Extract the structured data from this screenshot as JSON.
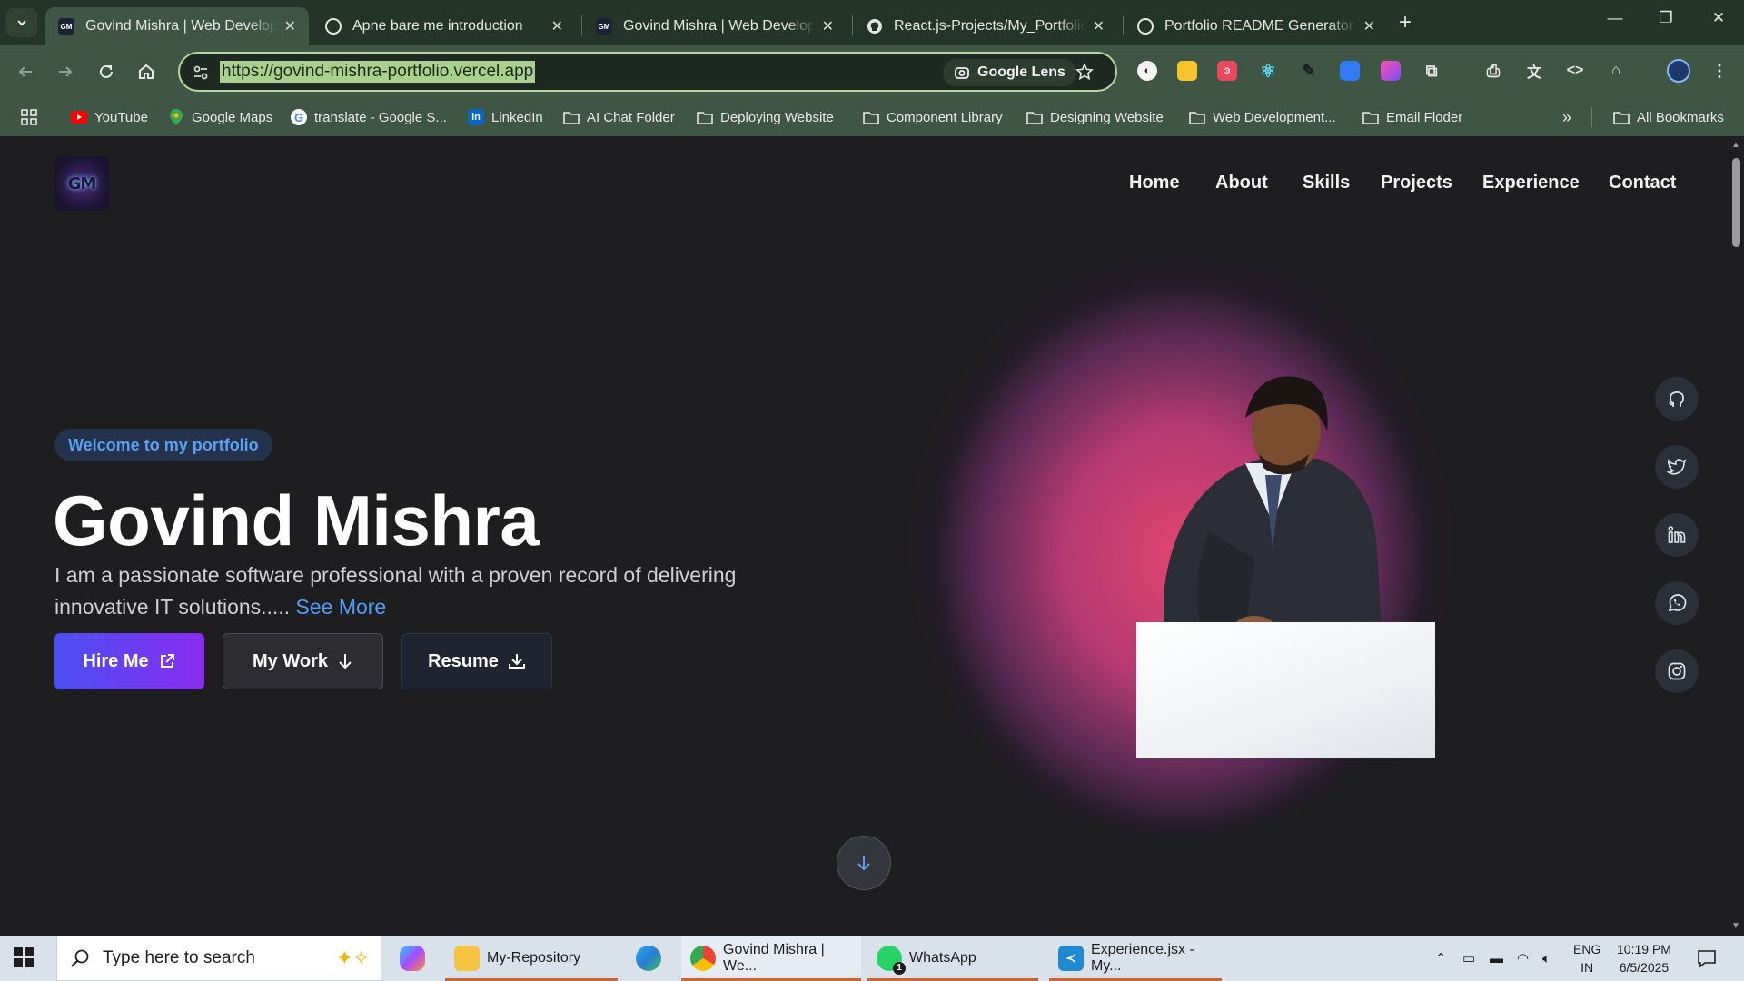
{
  "browser": {
    "tabs": [
      {
        "title": "Govind Mishra | Web Developer",
        "favicon": "GM"
      },
      {
        "title": "Apne bare me introduction"
      },
      {
        "title": "Govind Mishra | Web Developer",
        "favicon": "GM"
      },
      {
        "title": "React.js-Projects/My_Portfolio at"
      },
      {
        "title": "Portfolio README Generator"
      }
    ],
    "url": "https://govind-mishra-portfolio.vercel.app",
    "lens_label": "Google Lens",
    "bookmarks": [
      {
        "label": "YouTube",
        "icon": "youtube-icon"
      },
      {
        "label": "Google Maps",
        "icon": "maps-icon"
      },
      {
        "label": "translate - Google S...",
        "icon": "google-icon"
      },
      {
        "label": "LinkedIn",
        "icon": "linkedin-icon"
      },
      {
        "label": "AI Chat Folder",
        "icon": "folder-icon"
      },
      {
        "label": "Deploying Website",
        "icon": "folder-icon"
      },
      {
        "label": "Component Library",
        "icon": "folder-icon"
      },
      {
        "label": "Designing Website",
        "icon": "folder-icon"
      },
      {
        "label": "Web Development...",
        "icon": "folder-icon"
      },
      {
        "label": "Email Floder",
        "icon": "folder-icon"
      }
    ],
    "all_bookmarks": "All Bookmarks"
  },
  "page": {
    "logo_text": "GM",
    "nav": [
      "Home",
      "About",
      "Skills",
      "Projects",
      "Experience",
      "Contact"
    ],
    "badge": "Welcome to my portfolio",
    "name": "Govind Mishra",
    "description": "I am a passionate software professional with a proven record of delivering innovative IT solutions.....",
    "see_more": "See More",
    "buttons": {
      "hire": "Hire Me",
      "work": "My Work",
      "resume": "Resume"
    },
    "socials": [
      "github-icon",
      "twitter-icon",
      "linkedin-icon",
      "whatsapp-icon",
      "instagram-icon"
    ]
  },
  "taskbar": {
    "search_placeholder": "Type here to search",
    "apps": [
      {
        "label": "My-Repository",
        "icon": "folder-icon"
      },
      {
        "label": "Govind Mishra | We...",
        "icon": "chrome-icon"
      },
      {
        "label": "WhatsApp",
        "icon": "whatsapp-icon"
      },
      {
        "label": "Experience.jsx - My...",
        "icon": "vscode-icon"
      }
    ],
    "lang": "ENG",
    "region": "IN",
    "time": "10:19 PM",
    "date": "6/5/2025",
    "whatsapp_badge": "1"
  }
}
